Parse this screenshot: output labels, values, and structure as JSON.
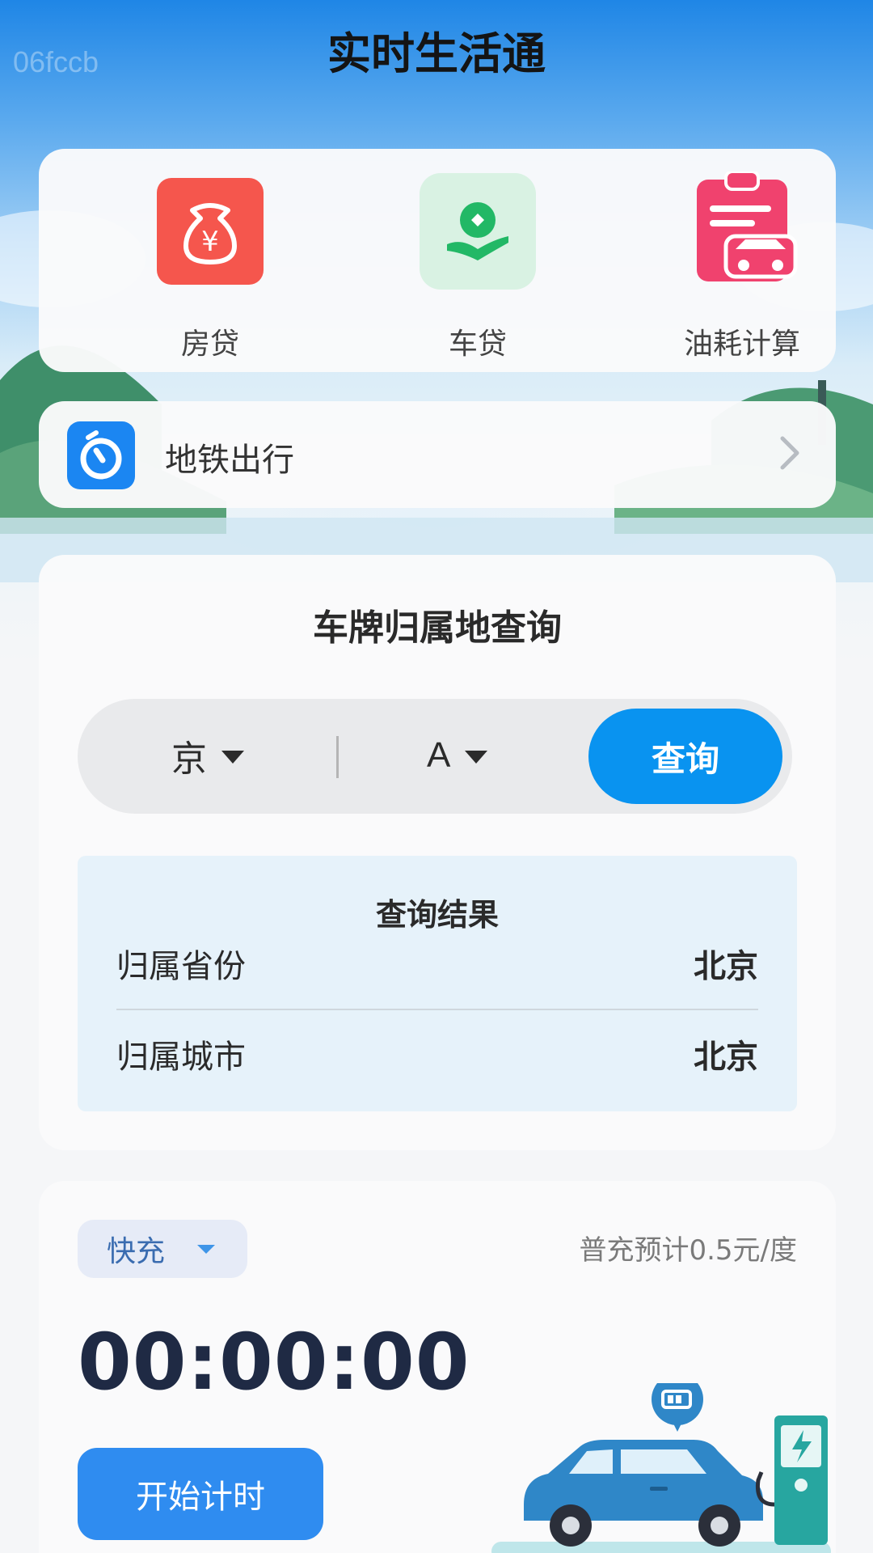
{
  "app": {
    "title": "实时生活通",
    "watermark": "06fccb"
  },
  "quick_tools": [
    {
      "label": "房贷",
      "icon": "money-bag-icon",
      "color": "#f5564d"
    },
    {
      "label": "车贷",
      "icon": "hand-coin-icon",
      "color": "#22b866"
    },
    {
      "label": "油耗计算",
      "icon": "car-clipboard-icon",
      "color": "#f0426e"
    }
  ],
  "metro": {
    "label": "地铁出行",
    "icon": "timer-icon"
  },
  "plate_query": {
    "title": "车牌归属地查询",
    "province": "京",
    "letter": "A",
    "button": "查询",
    "result": {
      "title": "查询结果",
      "rows": [
        {
          "key": "归属省份",
          "value": "北京"
        },
        {
          "key": "归属城市",
          "value": "北京"
        }
      ]
    }
  },
  "charging": {
    "mode": "快充",
    "price_note": "普充预计0.5元/度",
    "timer": "00:00:00",
    "start_button": "开始计时"
  },
  "colors": {
    "accent": "#0993f0",
    "start": "#2f8cf0",
    "timer": "#1f2a44"
  }
}
